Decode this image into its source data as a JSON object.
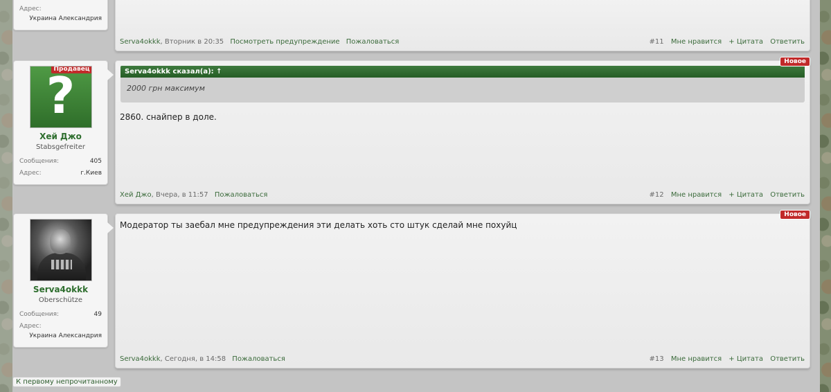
{
  "top_user": {
    "addr_label": "Адрес:",
    "addr_value": "Украина Александрия"
  },
  "top_post": {
    "author": "Serva4okkk",
    "date": ", Вторник в 20:35",
    "warn_link": "Посмотреть предупреждение",
    "report": "Пожаловаться",
    "num": "#11",
    "like": "Мне нравится",
    "quote": "+ Цитата",
    "reply": "Ответить"
  },
  "post2_user": {
    "badge": "Продавец",
    "name": "Хей Джо",
    "title": "Stabsgefreiter",
    "msgs_label": "Сообщения:",
    "msgs_value": "405",
    "addr_label": "Адрес:",
    "addr_value": "г.Киев"
  },
  "post2": {
    "new_badge": "Новое",
    "quote_head": "Serva4okkk сказал(а): ↑",
    "quote_text": "2000 грн максимум",
    "text": "2860. снайпер в доле.",
    "author": "Хей Джо",
    "date": ", Вчера, в 11:57",
    "report": "Пожаловаться",
    "num": "#12",
    "like": "Мне нравится",
    "quote": "+ Цитата",
    "reply": "Ответить"
  },
  "post3_user": {
    "name": "Serva4okkk",
    "title": "Oberschütze",
    "msgs_label": "Сообщения:",
    "msgs_value": "49",
    "addr_label": "Адрес:",
    "addr_value": "Украина Александрия"
  },
  "post3": {
    "new_badge": "Новое",
    "text": "Модератор ты заебал мне предупреждения эти делать хоть сто штук сделай мне похуйц",
    "author": "Serva4okkk",
    "date": ", Сегодня, в 14:58",
    "report": "Пожаловаться",
    "num": "#13",
    "like": "Мне нравится",
    "quote": "+ Цитата",
    "reply": "Ответить"
  },
  "unread_button": "К первому непрочитанному"
}
